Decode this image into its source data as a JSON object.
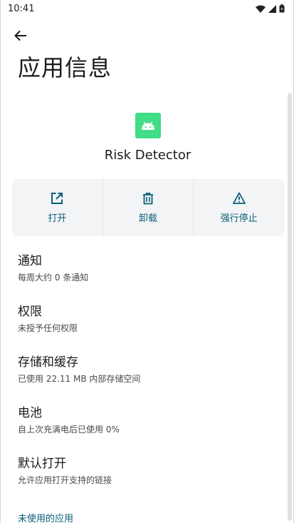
{
  "status_bar": {
    "time": "10:41"
  },
  "page": {
    "title": "应用信息"
  },
  "app": {
    "name": "Risk Detector",
    "icon_color": "#3ddc84"
  },
  "actions": [
    {
      "label": "打开",
      "icon": "open-in-new-icon"
    },
    {
      "label": "卸载",
      "icon": "trash-icon"
    },
    {
      "label": "强行停止",
      "icon": "warning-icon"
    }
  ],
  "settings": [
    {
      "title": "通知",
      "subtitle": "每周大约 0 条通知"
    },
    {
      "title": "权限",
      "subtitle": "未授予任何权限"
    },
    {
      "title": "存储和缓存",
      "subtitle": "已使用 22.11 MB 内部存储空间"
    },
    {
      "title": "电池",
      "subtitle": "自上次充满电后已使用 0%"
    },
    {
      "title": "默认打开",
      "subtitle": "允许应用打开支持的链接"
    }
  ],
  "section": {
    "unused_apps": "未使用的应用"
  },
  "colors": {
    "accent": "#0b5d78",
    "action_bg": "#f2f4f6"
  }
}
